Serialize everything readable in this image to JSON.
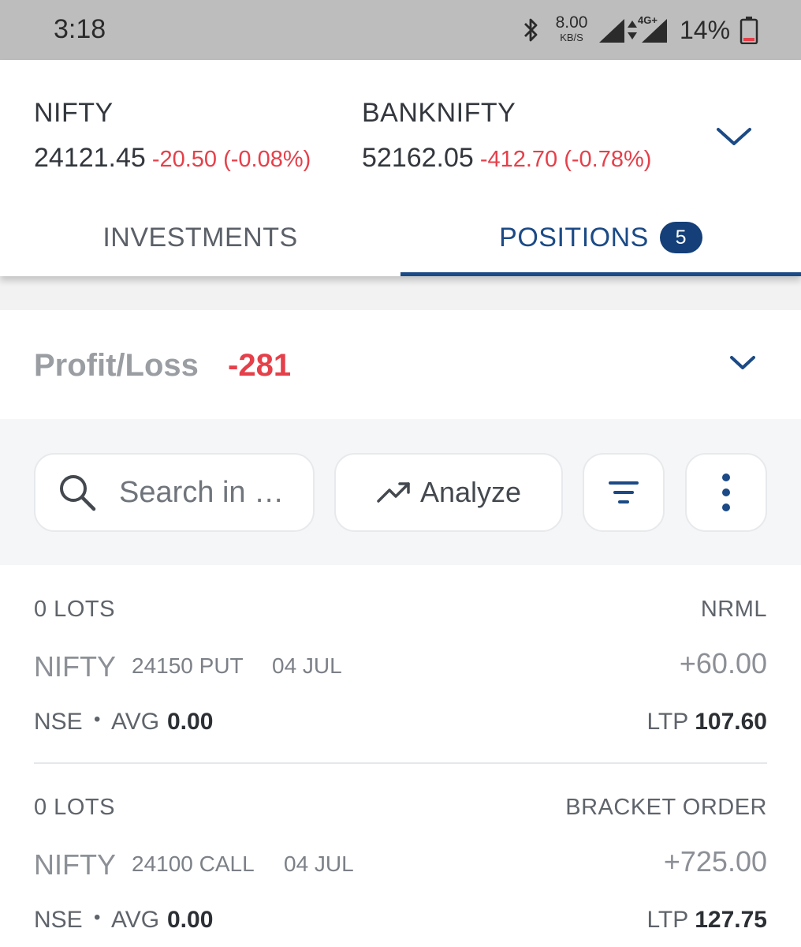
{
  "status_bar": {
    "time": "3:18",
    "net_speed_value": "8.00",
    "net_speed_unit": "KB/S",
    "network_type": "4G+",
    "battery": "14%"
  },
  "indices": [
    {
      "name": "NIFTY",
      "value": "24121.45",
      "change": "-20.50 (-0.08%)"
    },
    {
      "name": "BANKNIFTY",
      "value": "52162.05",
      "change": "-412.70 (-0.78%)"
    }
  ],
  "tabs": {
    "investments": "INVESTMENTS",
    "positions": "POSITIONS",
    "positions_count": "5"
  },
  "profit_loss": {
    "label": "Profit/Loss",
    "value": "-281"
  },
  "toolbar": {
    "search_placeholder": "Search in …",
    "analyze_label": "Analyze"
  },
  "positions": [
    {
      "lots": "0 LOTS",
      "product": "NRML",
      "symbol": "NIFTY",
      "strike": "24150 PUT",
      "expiry": "04 JUL",
      "pnl": "+60.00",
      "exchange": "NSE",
      "avg_label": "AVG",
      "avg": "0.00",
      "ltp_label": "LTP",
      "ltp": "107.60"
    },
    {
      "lots": "0 LOTS",
      "product": "BRACKET ORDER",
      "symbol": "NIFTY",
      "strike": "24100 CALL",
      "expiry": "04 JUL",
      "pnl": "+725.00",
      "exchange": "NSE",
      "avg_label": "AVG",
      "avg": "0.00",
      "ltp_label": "LTP",
      "ltp": "127.75"
    }
  ],
  "colors": {
    "accent": "#1b4a86",
    "loss": "#e5404a",
    "badge": "#143f78"
  }
}
